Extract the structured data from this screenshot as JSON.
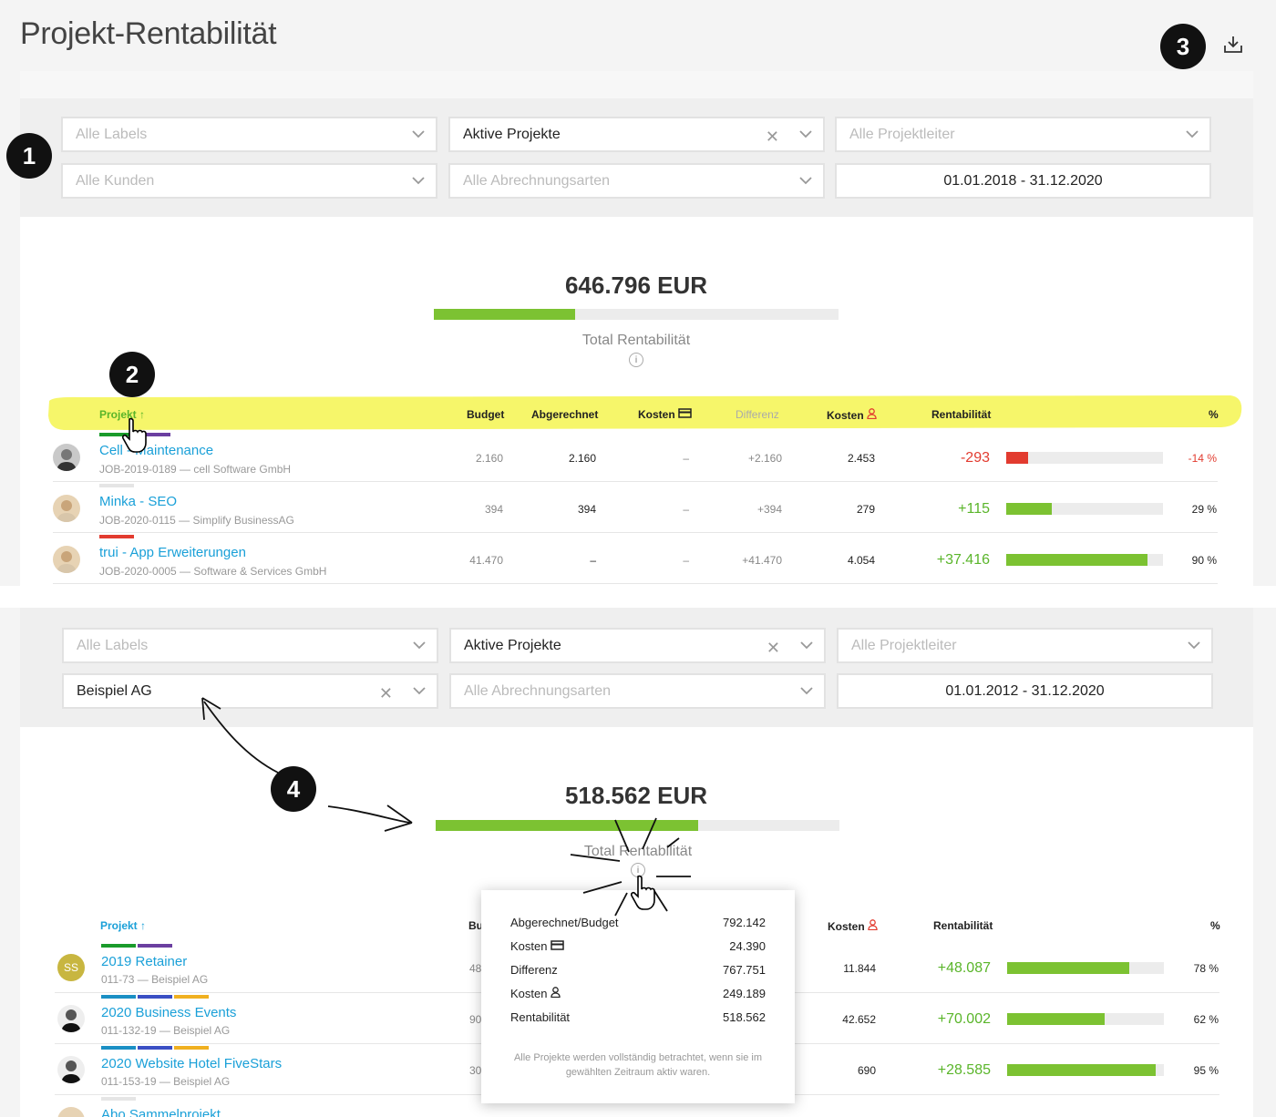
{
  "page": {
    "title": "Projekt-Rentabilität"
  },
  "badges": {
    "b1": "1",
    "b2": "2",
    "b3": "3",
    "b4": "4"
  },
  "icons": {
    "download": "download-icon",
    "info": "info-icon",
    "card": "credit-card-icon",
    "person": "person-icon",
    "sort": "sort-arrow-up-icon",
    "cursor": "hand-cursor-icon"
  },
  "colors": {
    "accent": "#1aa0d8",
    "positive": "#5ab52a",
    "negative": "#e23b2f",
    "highlight": "#f6f66a",
    "bar_fill": "#7cc232"
  },
  "panel1": {
    "filters": {
      "labels": "Alle Labels",
      "status": "Aktive Projekte",
      "leader": "Alle Projektleiter",
      "customers": "Alle Kunden",
      "billing": "Alle Abrechnungsarten",
      "daterange": "01.01.2018 - 31.12.2020"
    },
    "total": {
      "amount": "646.796 EUR",
      "label": "Total Rentabilität",
      "progress": 0.35
    },
    "headers": {
      "projekt": "Projekt",
      "sort": "↑",
      "budget": "Budget",
      "abgerechnet": "Abgerechnet",
      "kosten1": "Kosten",
      "differenz": "Differenz",
      "kosten2": "Kosten",
      "rentabilitaet": "Rentabilität",
      "pct": "%"
    },
    "rows": [
      {
        "title": "Cell - Maintenance",
        "sub": "JOB-2019-0189 — cell Software GmbH",
        "budget": "2.160",
        "abgerechnet": "2.160",
        "kosten1": "–",
        "differenz": "+2.160",
        "kosten2": "2.453",
        "rent": "-293",
        "pct": "-14 %",
        "fill": 0.14,
        "negative": true,
        "labels": [
          "#1a9b2b",
          "#6b3fa0"
        ]
      },
      {
        "title": "Minka - SEO",
        "sub": "JOB-2020-0115 — Simplify BusinessAG",
        "budget": "394",
        "abgerechnet": "394",
        "kosten1": "–",
        "differenz": "+394",
        "kosten2": "279",
        "rent": "+115",
        "pct": "29 %",
        "fill": 0.29,
        "negative": false,
        "labels": [
          "#e5e5e5"
        ]
      },
      {
        "title": "trui - App Erweiterungen",
        "sub": "JOB-2020-0005 — Software & Services GmbH",
        "budget": "41.470",
        "abgerechnet": "–",
        "kosten1": "–",
        "differenz": "+41.470",
        "kosten2": "4.054",
        "rent": "+37.416",
        "pct": "90 %",
        "fill": 0.9,
        "negative": false,
        "labels": [
          "#e23b2f"
        ]
      }
    ]
  },
  "panel2": {
    "filters": {
      "labels": "Alle Labels",
      "status": "Aktive Projekte",
      "leader": "Alle Projektleiter",
      "customers": "Beispiel AG",
      "billing": "Alle Abrechnungsarten",
      "daterange": "01.01.2012 - 31.12.2020"
    },
    "total": {
      "amount": "518.562 EUR",
      "label": "Total Rentabilität",
      "progress": 0.65
    },
    "headers": {
      "projekt": "Projekt",
      "sort": "↑",
      "budget": "Bu",
      "kosten2": "Kosten",
      "rentabilitaet": "Rentabilität",
      "pct": "%"
    },
    "rows": [
      {
        "title": "2019 Retainer",
        "sub": "011-73 — Beispiel AG",
        "budget": "48",
        "kosten2": "11.844",
        "rent": "+48.087",
        "pct": "78 %",
        "fill": 0.78,
        "initials": "SS",
        "labels": [
          "#1a9b2b",
          "#6b3fa0"
        ]
      },
      {
        "title": "2020 Business Events",
        "sub": "011-132-19 — Beispiel AG",
        "budget": "90",
        "kosten2": "42.652",
        "rent": "+70.002",
        "pct": "62 %",
        "fill": 0.62,
        "labels": [
          "#1a8fc4",
          "#3a4fc4",
          "#f0b020"
        ]
      },
      {
        "title": "2020 Website Hotel FiveStars",
        "sub": "011-153-19 — Beispiel AG",
        "budget": "30",
        "kosten2": "690",
        "rent": "+28.585",
        "pct": "95 %",
        "fill": 0.95,
        "labels": [
          "#1a8fc4",
          "#3a4fc4",
          "#f0b020"
        ]
      },
      {
        "title": "Abo Sammelprojekt",
        "labels": [
          "#e5e5e5"
        ]
      }
    ],
    "tooltip": {
      "rows": [
        {
          "k": "Abgerechnet/Budget",
          "v": "792.142"
        },
        {
          "k": "Kosten",
          "v": "24.390",
          "icon": "card"
        },
        {
          "k": "Differenz",
          "v": "767.751"
        },
        {
          "k": "Kosten",
          "v": "249.189",
          "icon": "person"
        },
        {
          "k": "Rentabilität",
          "v": "518.562"
        }
      ],
      "note": "Alle Projekte werden vollständig betrachtet, wenn sie im gewählten Zeitraum aktiv waren."
    }
  }
}
